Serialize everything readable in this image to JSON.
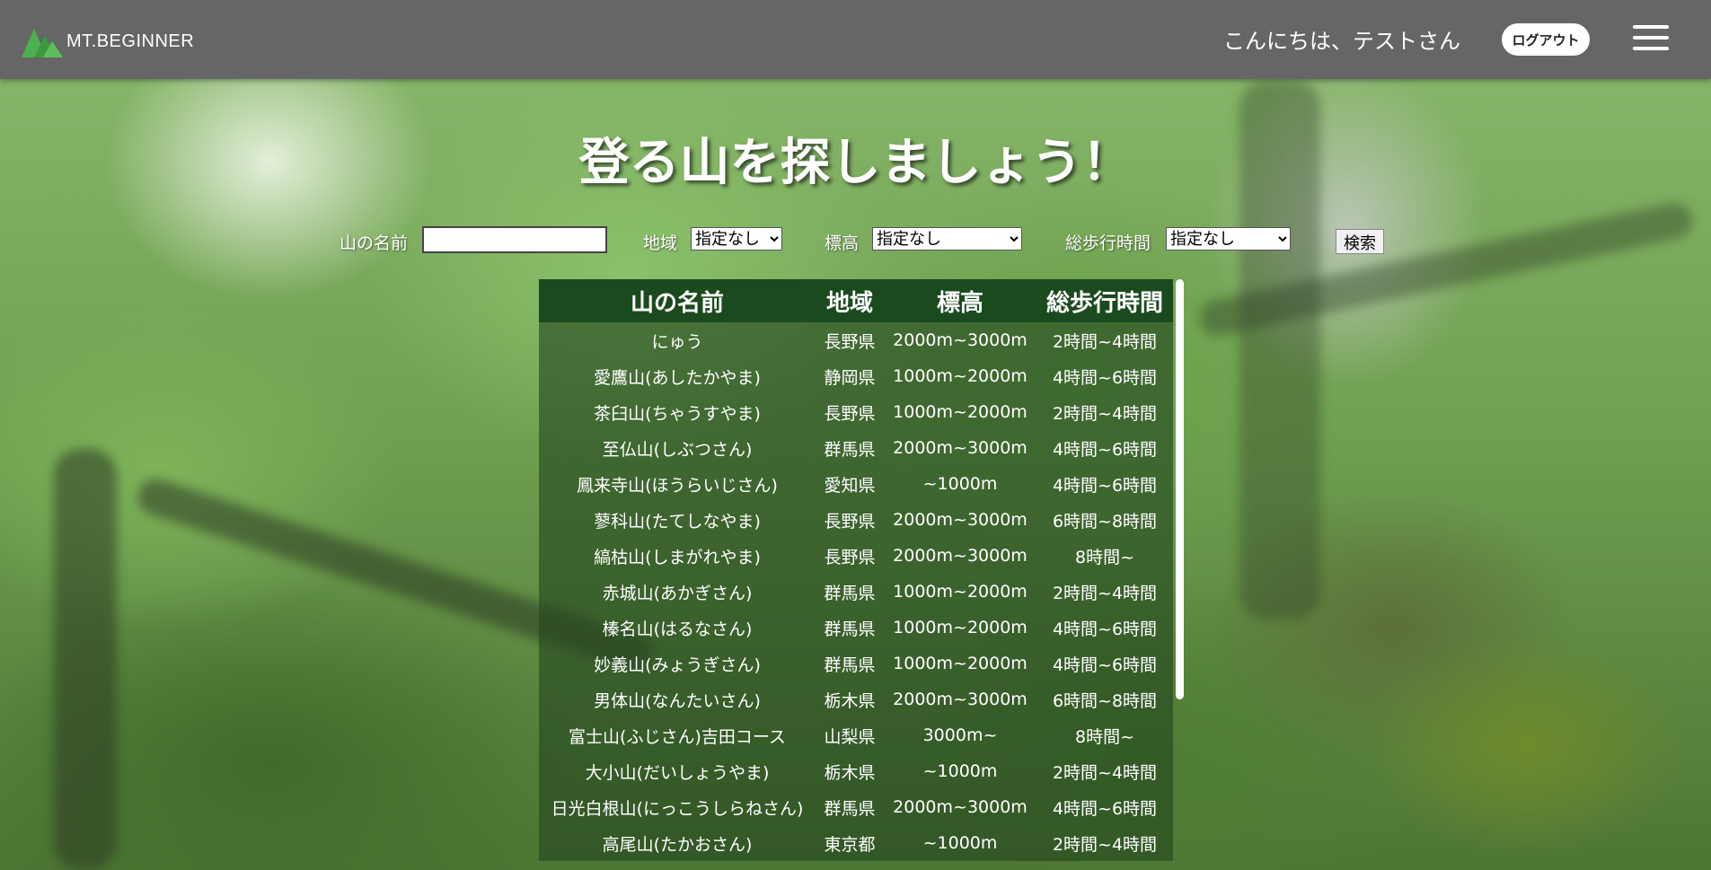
{
  "header": {
    "logo_text": "MT.BEGINNER",
    "greeting": "こんにちは、テストさん",
    "logout_label": "ログアウト"
  },
  "page_title": "登る山を探しましょう！",
  "search": {
    "name_label": "山の名前",
    "name_value": "",
    "region_label": "地域",
    "region_selected": "指定なし",
    "altitude_label": "標高",
    "altitude_selected": "指定なし",
    "time_label": "総歩行時間",
    "time_selected": "指定なし",
    "submit_label": "検索"
  },
  "table": {
    "headers": [
      "山の名前",
      "地域",
      "標高",
      "総歩行時間"
    ],
    "rows": [
      [
        "にゅう",
        "長野県",
        "2000m~3000m",
        "2時間~4時間"
      ],
      [
        "愛鷹山(あしたかやま)",
        "静岡県",
        "1000m~2000m",
        "4時間~6時間"
      ],
      [
        "茶臼山(ちゃうすやま)",
        "長野県",
        "1000m~2000m",
        "2時間~4時間"
      ],
      [
        "至仏山(しぶつさん)",
        "群馬県",
        "2000m~3000m",
        "4時間~6時間"
      ],
      [
        "鳳来寺山(ほうらいじさん)",
        "愛知県",
        "~1000m",
        "4時間~6時間"
      ],
      [
        "蓼科山(たてしなやま)",
        "長野県",
        "2000m~3000m",
        "6時間~8時間"
      ],
      [
        "縞枯山(しまがれやま)",
        "長野県",
        "2000m~3000m",
        "8時間~"
      ],
      [
        "赤城山(あかぎさん)",
        "群馬県",
        "1000m~2000m",
        "2時間~4時間"
      ],
      [
        "榛名山(はるなさん)",
        "群馬県",
        "1000m~2000m",
        "4時間~6時間"
      ],
      [
        "妙義山(みょうぎさん)",
        "群馬県",
        "1000m~2000m",
        "4時間~6時間"
      ],
      [
        "男体山(なんたいさん)",
        "栃木県",
        "2000m~3000m",
        "6時間~8時間"
      ],
      [
        "富士山(ふじさん)吉田コース",
        "山梨県",
        "3000m~",
        "8時間~"
      ],
      [
        "大小山(だいしょうやま)",
        "栃木県",
        "~1000m",
        "2時間~4時間"
      ],
      [
        "日光白根山(にっこうしらねさん)",
        "群馬県",
        "2000m~3000m",
        "4時間~6時間"
      ],
      [
        "高尾山(たかおさん)",
        "東京都",
        "~1000m",
        "2時間~4時間"
      ]
    ]
  },
  "colors": {
    "header_bg": "#666666",
    "table_header_bg": "#1c4a1f",
    "logo_green": "#4caf50"
  }
}
